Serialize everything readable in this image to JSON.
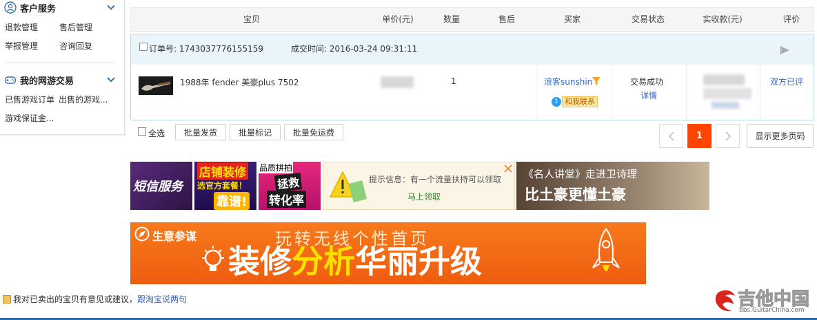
{
  "sidebar": {
    "customer_service": {
      "title": "客户服务",
      "links": [
        "退款管理",
        "售后管理",
        "举报管理",
        "咨询回复"
      ]
    },
    "game_trade": {
      "title": "我的网游交易",
      "links": [
        "已售游戏订单",
        "出售的游戏...",
        "游戏保证金..."
      ]
    }
  },
  "table": {
    "headers": [
      "宝贝",
      "单价(元)",
      "数量",
      "售后",
      "买家",
      "交易状态",
      "实收款(元)",
      "评价"
    ]
  },
  "order": {
    "number_label": "订单号: 1743037776155159",
    "time_label": "成交时间: 2016-03-24 09:31:11",
    "item_title": "1988年 fender 美豪plus 7502",
    "quantity": "1",
    "buyer": "浪客sunshin",
    "contact_badge": "和我联系",
    "status": "交易成功",
    "detail_link": "详情",
    "review": "双方已评"
  },
  "batch": {
    "select_all": "全选",
    "ship": "批量发货",
    "mark": "批量标记",
    "free_shipping": "批量免运费"
  },
  "pagination": {
    "current_page": "1",
    "more_pages": "显示更多页码"
  },
  "ads": {
    "sms": "短信服务",
    "decor_top": "店铺装修",
    "decor_mid": "选官方套餐！",
    "decor_bot": "靠谱!",
    "quality_label": "品质拼拍",
    "rescue_1": "拯救",
    "rescue_2": "转化率",
    "tip_text": "提示信息：有一个流量扶持可以领取",
    "tip_link": "马上领取",
    "lecture_1": "《名人讲堂》走进卫诗理",
    "lecture_2": "比土豪更懂土豪",
    "banner_brand": "生意参谋",
    "banner_top": "玩转无线个性首页",
    "banner_main_a": "装修",
    "banner_main_b": "分析",
    "banner_main_c": "华丽升级"
  },
  "footer": {
    "feedback_text": "我对已卖出的宝贝有意见或建议，",
    "feedback_link": "跟淘宝说两句"
  },
  "watermark": {
    "cn": "吉他中国",
    "en": "bbs.GuitarChina.com"
  },
  "colors": {
    "link": "#3366cc",
    "page_active": "#f40",
    "bottom_bar": "#2f6aad",
    "banner_orange": "#f26a17"
  }
}
